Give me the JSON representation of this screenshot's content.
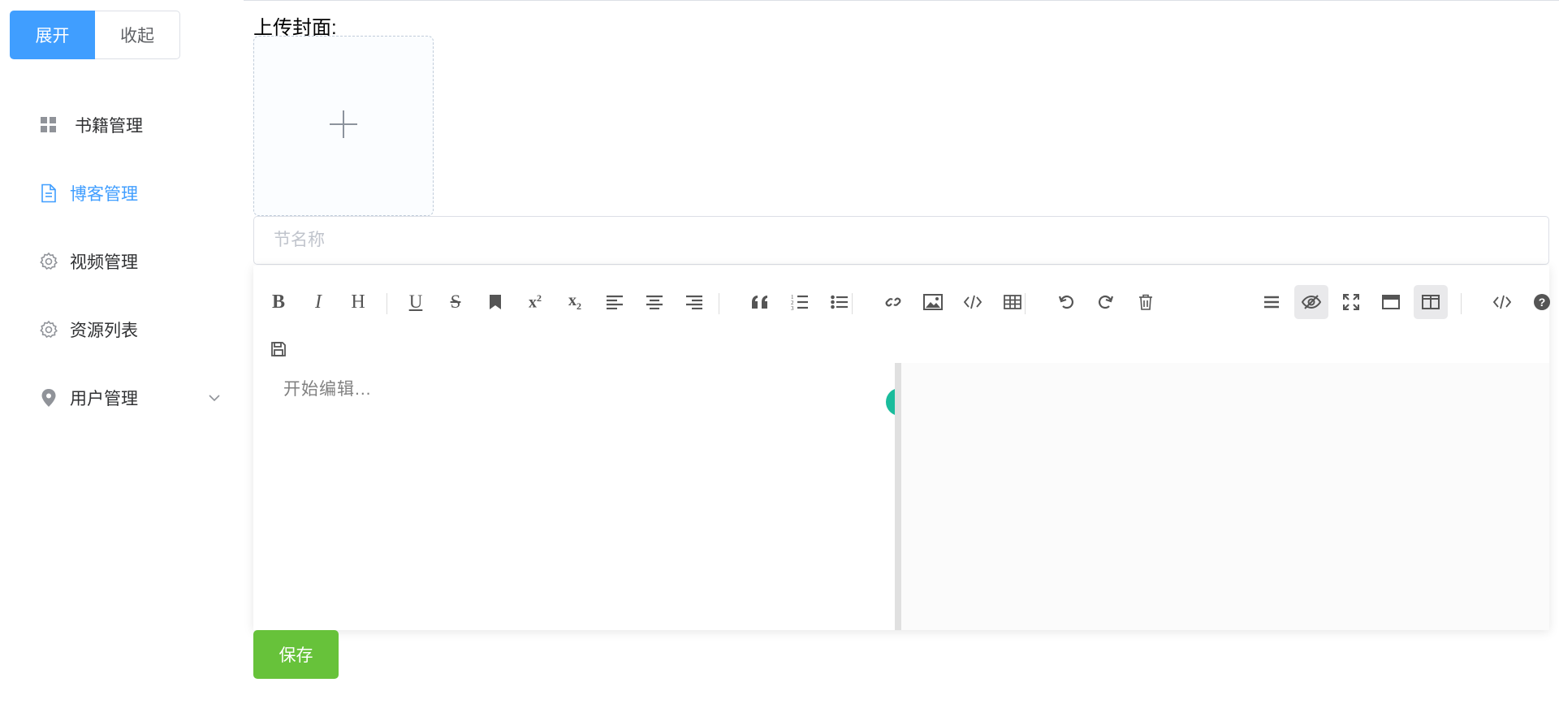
{
  "sidebar": {
    "expand_label": "展开",
    "collapse_label": "收起",
    "items": [
      {
        "label": "书籍管理",
        "icon": "grid-icon"
      },
      {
        "label": "博客管理",
        "icon": "document-icon",
        "active": true
      },
      {
        "label": "视频管理",
        "icon": "gear-icon"
      },
      {
        "label": "资源列表",
        "icon": "gear-icon"
      },
      {
        "label": "用户管理",
        "icon": "location-pin-icon",
        "has_submenu": true
      }
    ]
  },
  "main": {
    "upload_label": "上传封面:",
    "title_placeholder": "节名称",
    "editor": {
      "placeholder": "开始编辑...",
      "toolbar_left": [
        "bold-icon",
        "italic-icon",
        "heading-icon",
        "underline-icon",
        "strikethrough-icon",
        "bookmark-icon",
        "superscript-icon",
        "subscript-icon",
        "align-left-icon",
        "align-center-icon",
        "align-right-icon",
        "quote-icon",
        "ordered-list-icon",
        "unordered-list-icon",
        "link-icon",
        "image-icon",
        "code-icon",
        "table-icon",
        "undo-icon",
        "redo-icon",
        "trash-icon",
        "save-icon"
      ],
      "toolbar_right": [
        "navigation-icon",
        "preview-toggle-icon",
        "fullscreen-icon",
        "read-mode-icon",
        "subfield-icon",
        "html-code-icon",
        "help-icon"
      ]
    },
    "save_label": "保存"
  },
  "colors": {
    "primary": "#409eff",
    "success": "#67c23a",
    "accent_scroll": "#1abc9c"
  }
}
